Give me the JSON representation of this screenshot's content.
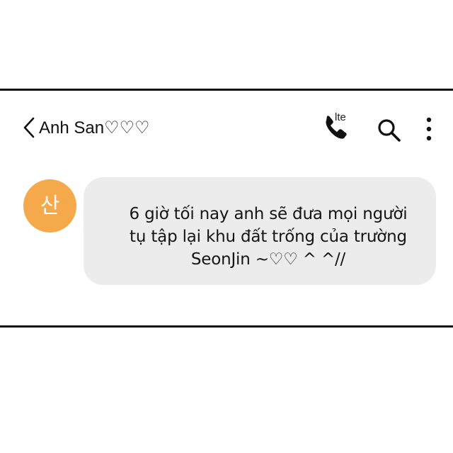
{
  "header": {
    "contact_name": "Anh San♡♡♡",
    "network_label": "lte",
    "icons": [
      "chevron-left-icon",
      "phone-icon",
      "search-icon",
      "more-vertical-icon"
    ]
  },
  "conversation": {
    "avatar_text": "산",
    "avatar_color": "#f5a94a",
    "message": "6 giờ tối nay anh sẽ đưa mọi người\ntụ tập lại khu đất trống của trường\nSeonJin ~♡♡ ^ ^//",
    "bubble_color": "#ececec"
  }
}
